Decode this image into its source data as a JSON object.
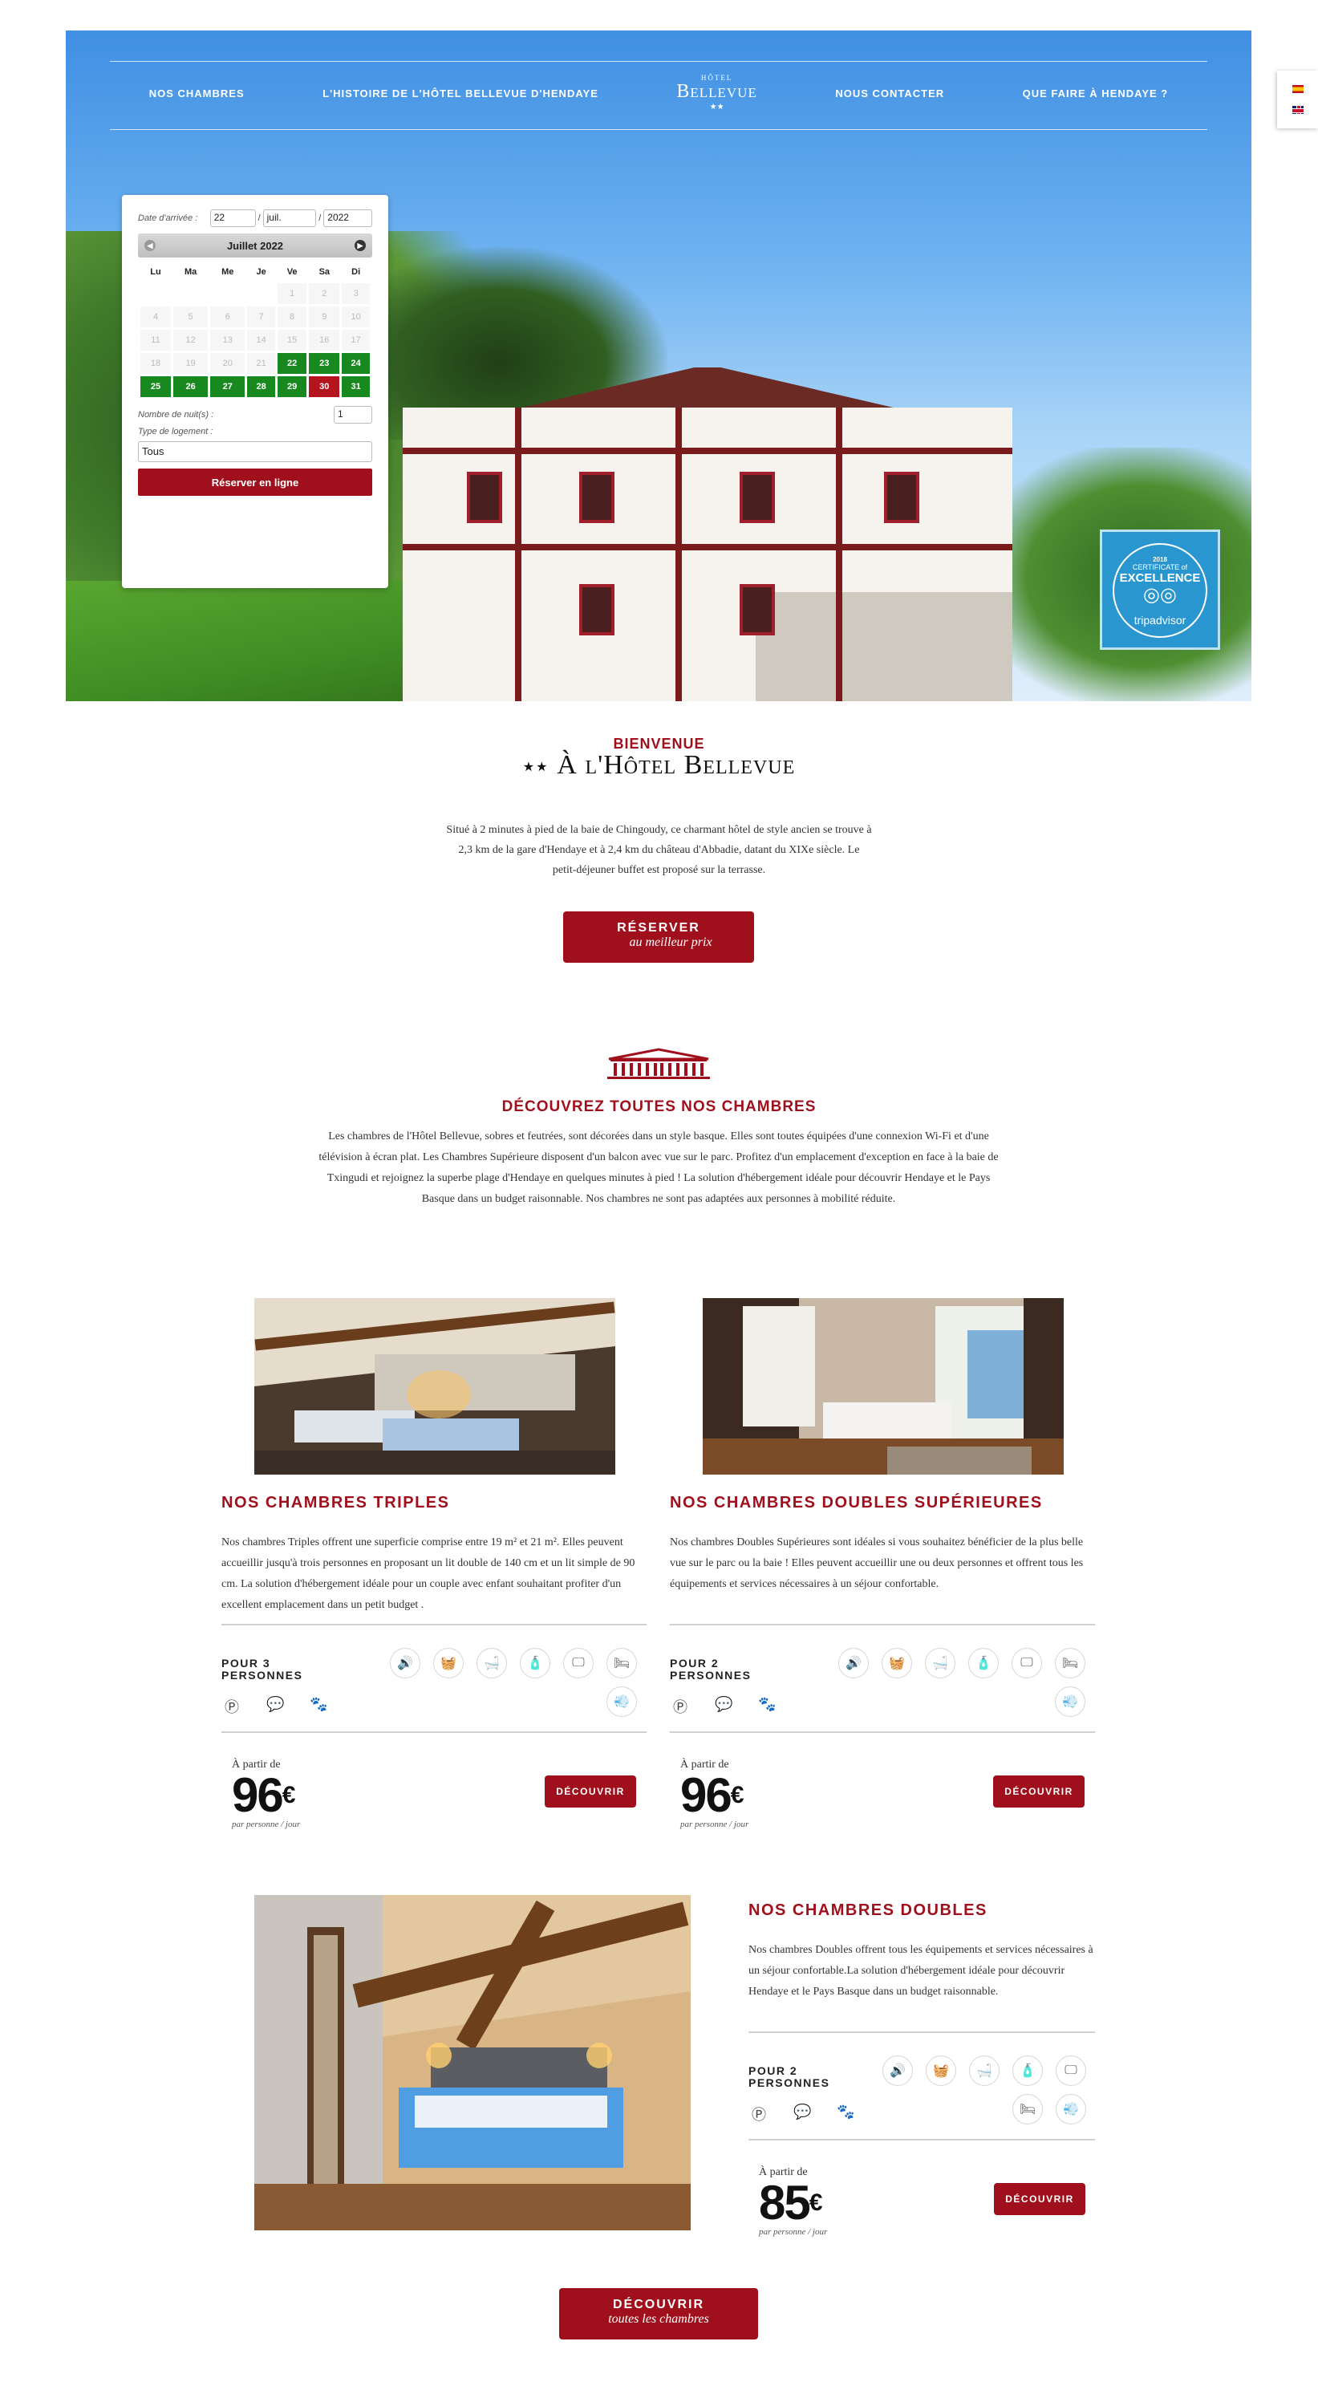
{
  "nav": {
    "items": [
      "NOS CHAMBRES",
      "L'HISTOIRE DE L'HÔTEL BELLEVUE D'HENDAYE",
      "NOUS CONTACTER",
      "QUE FAIRE À HENDAYE ?"
    ],
    "logo": {
      "small": "HÔTEL",
      "big": "Bellevue",
      "stars": "★★"
    }
  },
  "booking": {
    "arrival_label": "Date d'arrivée :",
    "day": "22",
    "month": "juil.",
    "year": "2022",
    "calendar_title": "Juillet 2022",
    "weekdays": [
      "Lu",
      "Ma",
      "Me",
      "Je",
      "Ve",
      "Sa",
      "Di"
    ],
    "weeks": [
      [
        "",
        "",
        "",
        "",
        "1",
        "2",
        "3"
      ],
      [
        "4",
        "5",
        "6",
        "7",
        "8",
        "9",
        "10"
      ],
      [
        "11",
        "12",
        "13",
        "14",
        "15",
        "16",
        "17"
      ],
      [
        "18",
        "19",
        "20",
        "21",
        "22",
        "23",
        "24"
      ],
      [
        "25",
        "26",
        "27",
        "28",
        "29",
        "30",
        "31"
      ]
    ],
    "available_days": [
      "22",
      "23",
      "24",
      "25",
      "26",
      "27",
      "28",
      "29",
      "31"
    ],
    "full_days": [
      "30"
    ],
    "nights_label": "Nombre de nuit(s) :",
    "nights_value": "1",
    "type_label": "Type de logement :",
    "type_value": "Tous",
    "book_label": "Réserver en ligne"
  },
  "tripadvisor": {
    "year": "2018",
    "certificate": "CERTIFICATE of",
    "excellence": "EXCELLENCE",
    "brand": "tripadvisor"
  },
  "welcome": {
    "kicker": "BIENVENUE",
    "stars": "★★",
    "title": "À l'Hôtel Bellevue",
    "text": "Situé à 2 minutes à pied de la baie de Chingoudy, ce charmant hôtel de style ancien se trouve à 2,3 km de la gare d'Hendaye et à 2,4 km du château d'Abbadie, datant du XIXe siècle. Le petit-déjeuner buffet est proposé sur la terrasse.",
    "cta_line1": "RÉSERVER",
    "cta_line2": "au meilleur prix"
  },
  "rooms_intro": {
    "title": "DÉCOUVREZ TOUTES NOS CHAMBRES",
    "text": "Les chambres de l'Hôtel Bellevue, sobres et feutrées, sont décorées dans un style basque. Elles sont toutes équipées d'une connexion Wi-Fi et d'une télévision à écran plat. Les Chambres Supérieure disposent d'un balcon avec vue sur le parc. Profitez d'un emplacement d'exception en face à la baie de Txingudi et rejoignez la superbe plage d'Hendaye en quelques minutes à pied ! La solution d'hébergement idéale pour découvrir Hendaye et le Pays Basque dans un budget raisonnable. Nos chambres ne sont pas adaptées aux personnes à mobilité réduite."
  },
  "rooms": [
    {
      "title": "NOS CHAMBRES TRIPLES",
      "desc": "Nos chambres Triples offrent une superficie comprise entre 19 m² et 21 m². Elles peuvent accueillir jusqu'à trois personnes en proposant un lit double de 140 cm et un lit simple de 90 cm. La solution d'hébergement idéale pour un couple avec enfant souhaitant profiter d'un excellent emplacement dans un petit budget .",
      "pour_line1": "POUR 3",
      "pour_line2": "PERSONNES",
      "from": "À partir de",
      "price": "96",
      "currency": "€",
      "per": "par personne / jour",
      "button": "DÉCOUVRIR"
    },
    {
      "title": "NOS CHAMBRES DOUBLES SUPÉRIEURES",
      "desc": "Nos chambres Doubles Supérieures sont idéales si vous souhaitez bénéficier de la plus belle vue sur le parc ou la baie ! Elles peuvent accueillir une ou deux personnes et offrent tous les équipements et services nécessaires à un séjour confortable.",
      "pour_line1": "POUR 2",
      "pour_line2": "PERSONNES",
      "from": "À partir de",
      "price": "96",
      "currency": "€",
      "per": "par personne / jour",
      "button": "DÉCOUVRIR"
    },
    {
      "title": "NOS CHAMBRES DOUBLES",
      "desc": "Nos chambres Doubles offrent tous les équipements et services nécessaires à un séjour confortable.La solution d'hébergement idéale pour découvrir Hendaye et le Pays Basque dans un budget raisonnable.",
      "pour_line1": "POUR 2",
      "pour_line2": "PERSONNES",
      "from": "À partir de",
      "price": "85",
      "currency": "€",
      "per": "par personne / jour",
      "button": "DÉCOUVRIR"
    }
  ],
  "amenities": {
    "top": [
      "🔊",
      "🧺",
      "🛁",
      "🧴",
      "🖵",
      "🛏"
    ],
    "bottom": [
      "Ⓟ",
      "💬",
      "🐾"
    ],
    "extra": "💨"
  },
  "footer_cta": {
    "line1": "DÉCOUVRIR",
    "line2": "toutes les chambres"
  }
}
